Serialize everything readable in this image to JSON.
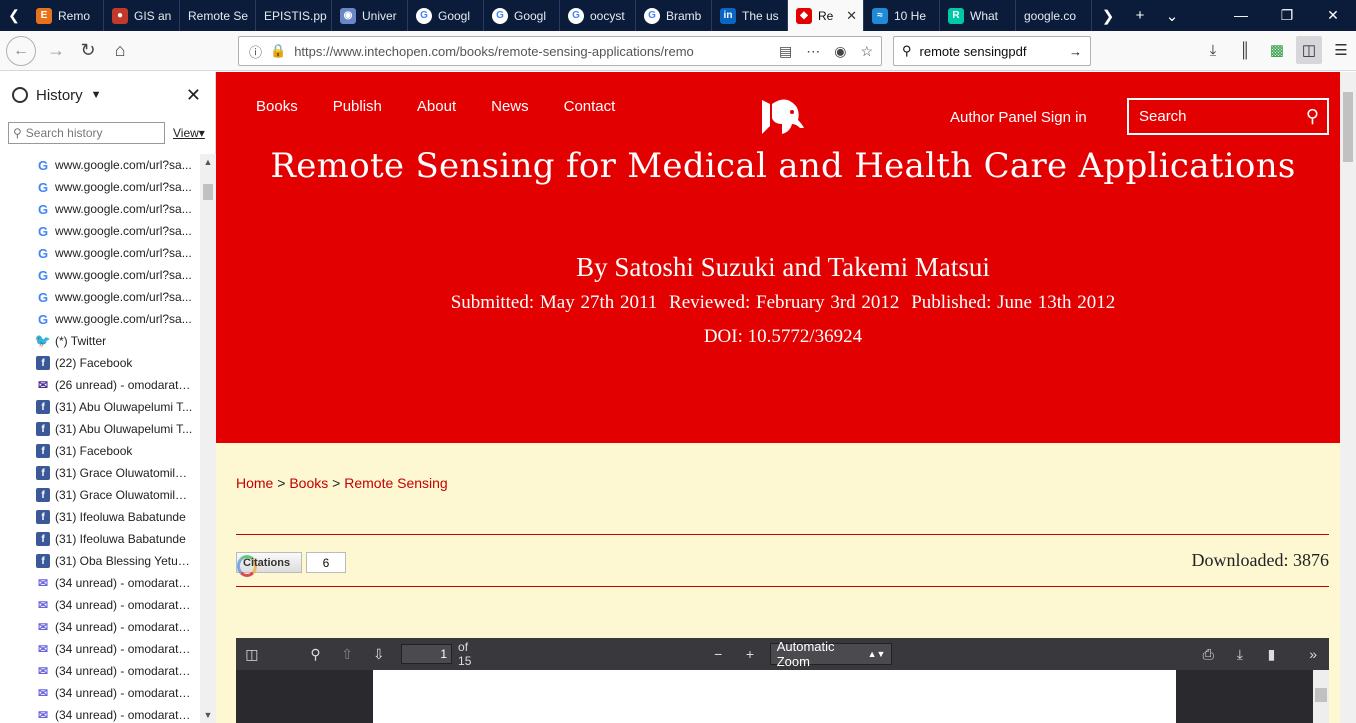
{
  "tabs": [
    {
      "label": "Remo",
      "icon": "elsevier-icon",
      "color": "#e9711c"
    },
    {
      "label": "GIS an",
      "icon": "spotlight-icon",
      "color": "#c0392b"
    },
    {
      "label": "Remote Se",
      "icon": "",
      "color": ""
    },
    {
      "label": "EPISTIS.pp",
      "icon": "",
      "color": ""
    },
    {
      "label": "Univer",
      "icon": "globe-icon",
      "color": "#6a88c8"
    },
    {
      "label": "Googl",
      "icon": "google-icon",
      "color": "#4285f4"
    },
    {
      "label": "Googl",
      "icon": "google-icon",
      "color": "#4285f4"
    },
    {
      "label": "oocyst",
      "icon": "google-icon",
      "color": "#4285f4"
    },
    {
      "label": "Bramb",
      "icon": "google-icon",
      "color": "#4285f4"
    },
    {
      "label": "The us",
      "icon": "linkedin-icon",
      "color": "#0a66c2"
    },
    {
      "label": "Re",
      "icon": "intechopen-icon",
      "color": "#e30000"
    },
    {
      "label": "10 He",
      "icon": "tab-icon",
      "color": "#1f8ad8"
    },
    {
      "label": "What",
      "icon": "researchgate-icon",
      "color": "#00c9a7"
    },
    {
      "label": "google.co",
      "icon": "",
      "color": ""
    }
  ],
  "nav": {
    "url": "https://www.intechopen.com/books/remote-sensing-applications/remo",
    "search_value": "remote sensingpdf"
  },
  "sidebar": {
    "title": "History",
    "search_placeholder": "Search history",
    "view_label": "View",
    "items": [
      {
        "label": "www.google.com/url?sa...",
        "icon": "google"
      },
      {
        "label": "www.google.com/url?sa...",
        "icon": "google"
      },
      {
        "label": "www.google.com/url?sa...",
        "icon": "google"
      },
      {
        "label": "www.google.com/url?sa...",
        "icon": "google"
      },
      {
        "label": "www.google.com/url?sa...",
        "icon": "google"
      },
      {
        "label": "www.google.com/url?sa...",
        "icon": "google"
      },
      {
        "label": "www.google.com/url?sa...",
        "icon": "google"
      },
      {
        "label": "www.google.com/url?sa...",
        "icon": "google"
      },
      {
        "label": "(*) Twitter",
        "icon": "twitter"
      },
      {
        "label": "(22) Facebook",
        "icon": "facebook"
      },
      {
        "label": "(26 unread) - omodarato...",
        "icon": "mail"
      },
      {
        "label": "(31) Abu Oluwapelumi T...",
        "icon": "facebook"
      },
      {
        "label": "(31) Abu Oluwapelumi T...",
        "icon": "facebook"
      },
      {
        "label": "(31) Facebook",
        "icon": "facebook"
      },
      {
        "label": "(31) Grace Oluwatomilol...",
        "icon": "facebook"
      },
      {
        "label": "(31) Grace Oluwatomilol...",
        "icon": "facebook"
      },
      {
        "label": "(31) Ifeoluwa Babatunde",
        "icon": "facebook"
      },
      {
        "label": "(31) Ifeoluwa Babatunde",
        "icon": "facebook"
      },
      {
        "label": "(31) Oba Blessing Yetunde",
        "icon": "facebook"
      },
      {
        "label": "(34 unread) - omodarato...",
        "icon": "mail2"
      },
      {
        "label": "(34 unread) - omodarato...",
        "icon": "mail2"
      },
      {
        "label": "(34 unread) - omodarato...",
        "icon": "mail2"
      },
      {
        "label": "(34 unread) - omodarato...",
        "icon": "mail2"
      },
      {
        "label": "(34 unread) - omodarato...",
        "icon": "mail2"
      },
      {
        "label": "(34 unread) - omodarato...",
        "icon": "mail2"
      },
      {
        "label": "(34 unread) - omodarato...",
        "icon": "mail2"
      }
    ]
  },
  "site": {
    "nav_items": [
      "Books",
      "Publish",
      "About",
      "News",
      "Contact"
    ],
    "author_panel": "Author Panel Sign in",
    "search_label": "Search",
    "title": "Remote Sensing for Medical and Health Care Applications",
    "authors": "By Satoshi Suzuki and Takemi Matsui",
    "submitted": "Submitted: May 27th 2011",
    "reviewed": "Reviewed: February 3rd 2012",
    "published": "Published: June 13th 2012",
    "doi": "DOI: 10.5772/36924",
    "breadcrumbs": {
      "home": "Home",
      "sep": ">",
      "books": "Books",
      "current": "Remote Sensing"
    },
    "citations_label": "Citations",
    "citations_count": "6",
    "downloaded": "Downloaded: 3876",
    "accent": "#e30000",
    "background": "#fdf8d2"
  },
  "pdf": {
    "page": "1",
    "of_label": "of 15",
    "zoom": "Automatic Zoom"
  }
}
